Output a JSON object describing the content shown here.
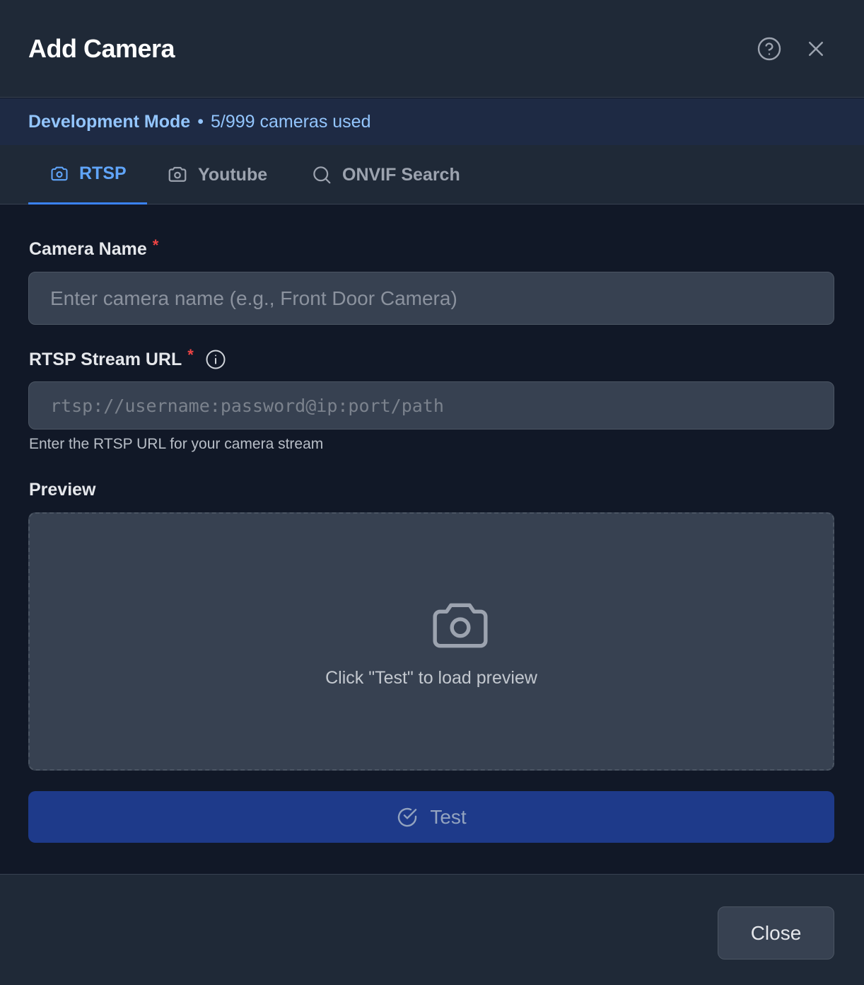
{
  "header": {
    "title": "Add Camera",
    "help_icon": "help-circle-icon",
    "close_icon": "close-icon"
  },
  "banner": {
    "mode": "Development Mode",
    "separator": "•",
    "usage": "5/999 cameras used"
  },
  "tabs": [
    {
      "label": "RTSP",
      "icon": "camera-icon",
      "active": true
    },
    {
      "label": "Youtube",
      "icon": "camera-icon",
      "active": false
    },
    {
      "label": "ONVIF Search",
      "icon": "search-icon",
      "active": false
    }
  ],
  "form": {
    "camera_name": {
      "label": "Camera Name",
      "required_mark": "*",
      "value": "",
      "placeholder": "Enter camera name (e.g., Front Door Camera)"
    },
    "rtsp_url": {
      "label": "RTSP Stream URL",
      "required_mark": "*",
      "info_icon": "info-icon",
      "value": "",
      "placeholder": "rtsp://username:password@ip:port/path",
      "help_text": "Enter the RTSP URL for your camera stream"
    },
    "preview": {
      "label": "Preview",
      "icon": "camera-icon",
      "message": "Click \"Test\" to load preview"
    },
    "test_button": {
      "label": "Test",
      "icon": "check-circle-icon"
    }
  },
  "footer": {
    "close_label": "Close"
  },
  "colors": {
    "accent": "#3b82f6",
    "accent_text": "#60a5fa",
    "banner_text": "#93c5fd",
    "required": "#ef4444",
    "test_button_bg": "#1e3a8a"
  }
}
